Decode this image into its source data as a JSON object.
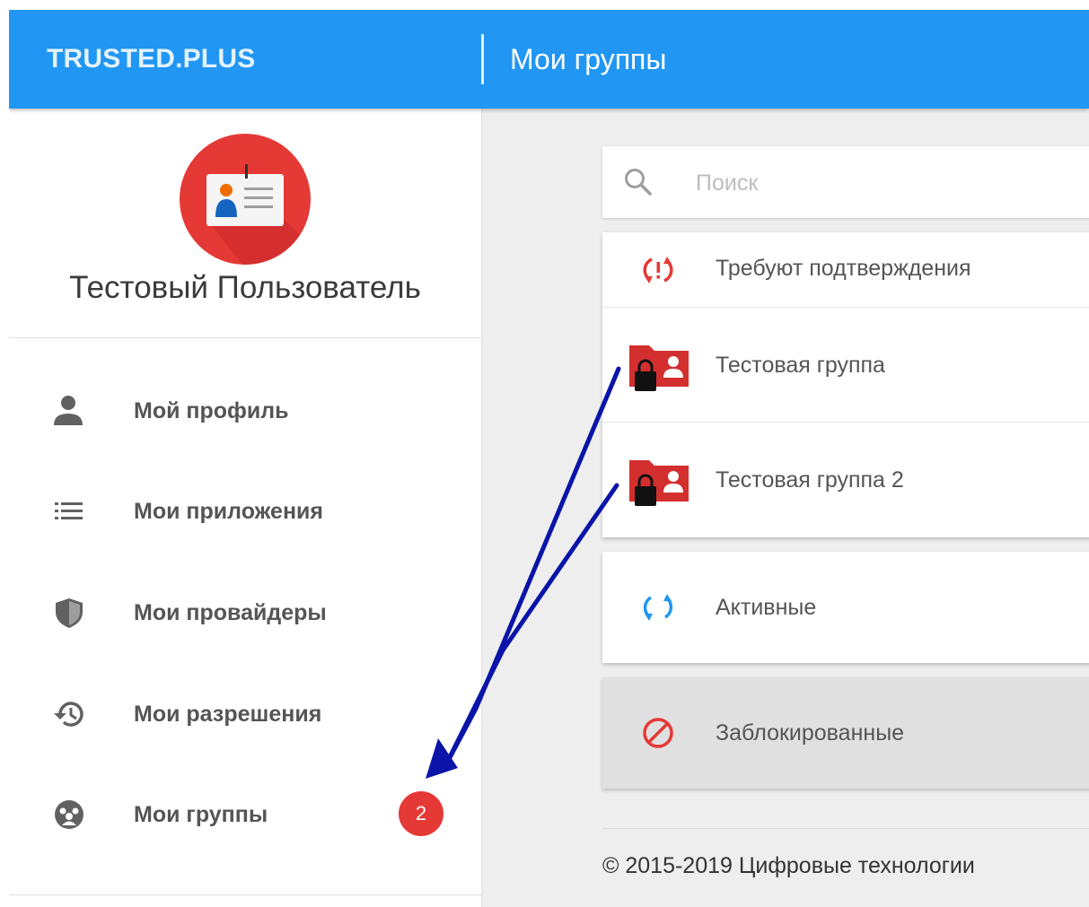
{
  "header": {
    "brand": "TRUSTED.PLUS",
    "title": "Мои группы",
    "color": "#2196f3"
  },
  "profile": {
    "avatar_icon": "id-card-icon",
    "name": "Тестовый Пользователь"
  },
  "sidebar": {
    "items": [
      {
        "label": "Мой профиль",
        "icon": "person-icon"
      },
      {
        "label": "Мои приложения",
        "icon": "list-icon"
      },
      {
        "label": "Мои провайдеры",
        "icon": "shield-icon"
      },
      {
        "label": "Мои разрешения",
        "icon": "history-icon"
      },
      {
        "label": "Мои группы",
        "icon": "group-icon",
        "badge": "2"
      }
    ]
  },
  "search": {
    "placeholder": "Поиск",
    "icon": "search-icon"
  },
  "sections": {
    "pending": {
      "title": "Требуют подтверждения",
      "icon": "sync-alert-icon",
      "groups": [
        {
          "name": "Тестовая группа",
          "icon": "locked-group-folder-icon"
        },
        {
          "name": "Тестовая группа 2",
          "icon": "locked-group-folder-icon"
        }
      ]
    },
    "active": {
      "title": "Активные",
      "icon": "sync-icon"
    },
    "blocked": {
      "title": "Заблокированные",
      "icon": "block-icon"
    }
  },
  "footer": {
    "text": "© 2015-2019 Цифровые технологии"
  },
  "colors": {
    "accent": "#2196f3",
    "danger": "#e53935",
    "annotation_arrow": "#0a14a8"
  }
}
